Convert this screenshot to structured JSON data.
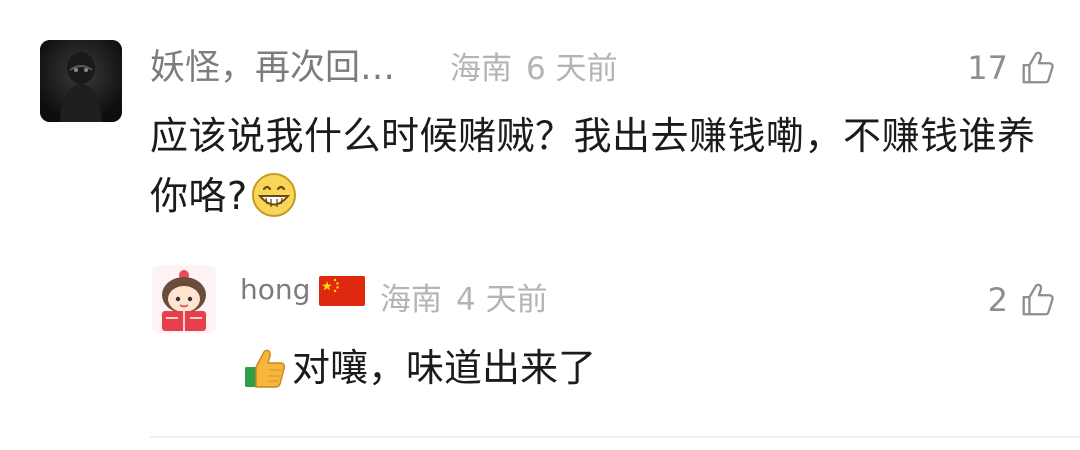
{
  "main_comment": {
    "author": "妖怪，再次回…",
    "location": "海南",
    "time": "6 天前",
    "like_count": "17",
    "text": "应该说我什么时候赌贼？我出去赚钱嘞，不赚钱谁养你咯?",
    "emoji": "grinning-face-emoji"
  },
  "reply": {
    "author": "hong",
    "author_badge": "china-flag-icon",
    "location": "海南",
    "time": "4 天前",
    "like_count": "2",
    "text": "对嚷，味道出来了",
    "emoji": "thumbs-up-emoji"
  },
  "colors": {
    "author_text": "#7c7c7c",
    "meta_text": "#b4b4b4",
    "body_text": "#1b1b1b",
    "divider": "#efefef"
  }
}
